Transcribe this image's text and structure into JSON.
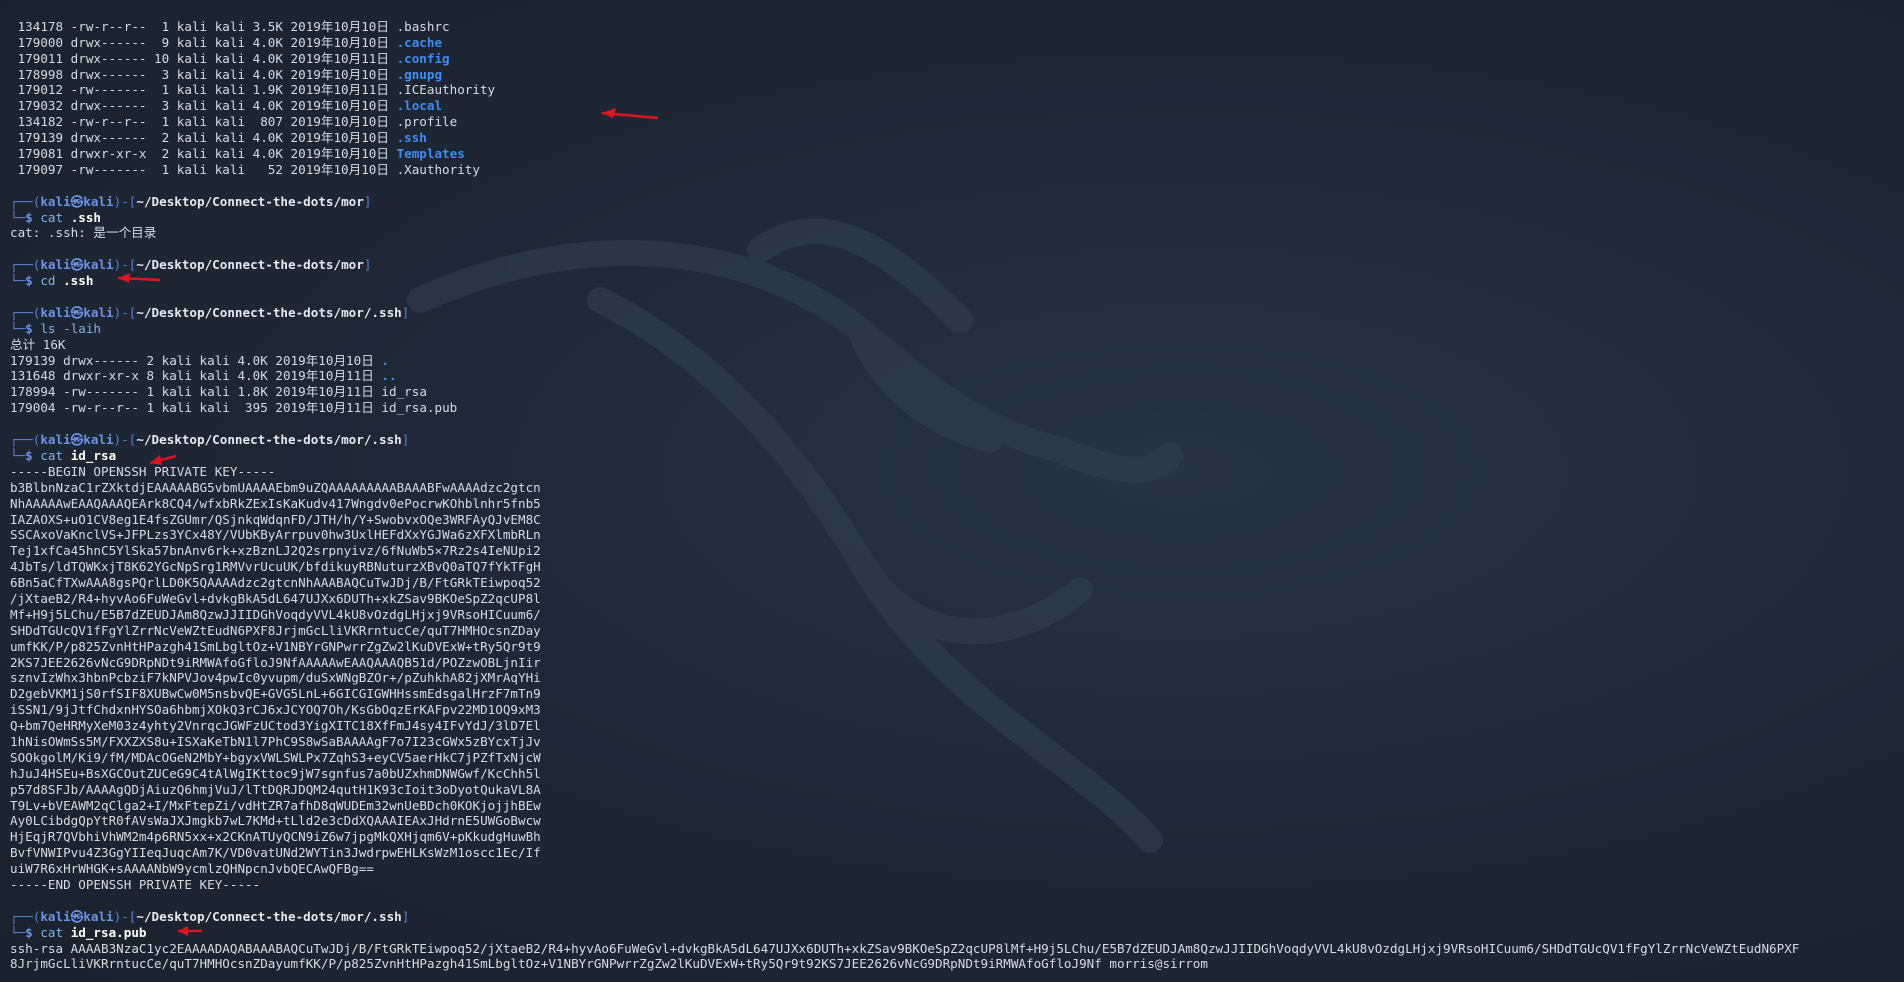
{
  "listing1": [
    {
      "inode": "134178",
      "perm": "-rw-r--r--",
      "links": " 1",
      "user": "kali",
      "group": "kali",
      "size": "3.5K",
      "date": "2019年10月10日",
      "name": ".bashrc",
      "dir": false
    },
    {
      "inode": "179000",
      "perm": "drwx------",
      "links": " 9",
      "user": "kali",
      "group": "kali",
      "size": "4.0K",
      "date": "2019年10月10日",
      "name": ".cache",
      "dir": true
    },
    {
      "inode": "179011",
      "perm": "drwx------",
      "links": "10",
      "user": "kali",
      "group": "kali",
      "size": "4.0K",
      "date": "2019年10月11日",
      "name": ".config",
      "dir": true
    },
    {
      "inode": "178998",
      "perm": "drwx------",
      "links": " 3",
      "user": "kali",
      "group": "kali",
      "size": "4.0K",
      "date": "2019年10月10日",
      "name": ".gnupg",
      "dir": true
    },
    {
      "inode": "179012",
      "perm": "-rw-------",
      "links": " 1",
      "user": "kali",
      "group": "kali",
      "size": "1.9K",
      "date": "2019年10月11日",
      "name": ".ICEauthority",
      "dir": false
    },
    {
      "inode": "179032",
      "perm": "drwx------",
      "links": " 3",
      "user": "kali",
      "group": "kali",
      "size": "4.0K",
      "date": "2019年10月10日",
      "name": ".local",
      "dir": true
    },
    {
      "inode": "134182",
      "perm": "-rw-r--r--",
      "links": " 1",
      "user": "kali",
      "group": "kali",
      "size": " 807",
      "date": "2019年10月10日",
      "name": ".profile",
      "dir": false
    },
    {
      "inode": "179139",
      "perm": "drwx------",
      "links": " 2",
      "user": "kali",
      "group": "kali",
      "size": "4.0K",
      "date": "2019年10月10日",
      "name": ".ssh",
      "dir": true
    },
    {
      "inode": "179081",
      "perm": "drwxr-xr-x",
      "links": " 2",
      "user": "kali",
      "group": "kali",
      "size": "4.0K",
      "date": "2019年10月10日",
      "name": "Templates",
      "dir": true
    },
    {
      "inode": "179097",
      "perm": "-rw-------",
      "links": " 1",
      "user": "kali",
      "group": "kali",
      "size": "  52",
      "date": "2019年10月10日",
      "name": ".Xauthority",
      "dir": false
    }
  ],
  "prompt": {
    "user": "kali",
    "at": "㉿",
    "host": "kali",
    "path_mor": "~/Desktop/Connect-the-dots/mor",
    "path_ssh": "~/Desktop/Connect-the-dots/mor/.ssh",
    "dollar": "$"
  },
  "commands": {
    "cat_ssh": {
      "name": "cat",
      "arg": ".ssh"
    },
    "cat_ssh_output": "cat: .ssh: 是一个目录",
    "cd_ssh": {
      "name": "cd",
      "arg": ".ssh"
    },
    "ls": {
      "name": "ls",
      "flag": "-laih"
    },
    "cat_idrsa": {
      "name": "cat",
      "arg": "id_rsa"
    },
    "cat_pub": {
      "name": "cat",
      "arg": "id_rsa.pub"
    }
  },
  "listing2_total": "总计 16K",
  "listing2": [
    {
      "inode": "179139",
      "perm": "drwx------",
      "links": "2",
      "user": "kali",
      "group": "kali",
      "size": "4.0K",
      "date": "2019年10月10日",
      "name": ".",
      "dir": true
    },
    {
      "inode": "131648",
      "perm": "drwxr-xr-x",
      "links": "8",
      "user": "kali",
      "group": "kali",
      "size": "4.0K",
      "date": "2019年10月11日",
      "name": "..",
      "dir": true
    },
    {
      "inode": "178994",
      "perm": "-rw-------",
      "links": "1",
      "user": "kali",
      "group": "kali",
      "size": "1.8K",
      "date": "2019年10月11日",
      "name": "id_rsa",
      "dir": false
    },
    {
      "inode": "179004",
      "perm": "-rw-r--r--",
      "links": "1",
      "user": "kali",
      "group": "kali",
      "size": " 395",
      "date": "2019年10月11日",
      "name": "id_rsa.pub",
      "dir": false
    }
  ],
  "private_key": [
    "-----BEGIN OPENSSH PRIVATE KEY-----",
    "b3BlbnNzaC1rZXktdjEAAAAABG5vbmUAAAAEbm9uZQAAAAAAAAABAAABFwAAAAdzc2gtcn",
    "NhAAAAAwEAAQAAAQEArk8CQ4/wfxbRkZExIsKaKudv417Wngdv0ePocrwKOhblnhr5fnb5",
    "IAZAOXS+uO1CV8eg1E4fsZGUmr/QSjnkqWdqnFD/JTH/h/Y+SwobvxOQe3WRFAyQJvEM8C",
    "SSCAxoVaKnclVS+JFPLzs3YCx48Y/VUbKByArrpuv0hw3UxlHEFdXxYGJWa6zXFXlmbRLn",
    "Tej1xfCa45hnC5YlSka57bnAnv6rk+xzBznLJ2Q2srpnyivz/6fNuWb5×7Rz2s4IeNUpi2",
    "4JbTs/ldTQWKxjT8K62YGcNpSrg1RMVvrUcuUK/bfdikuyRBNuturzXBvQ0aTQ7fYkTFgH",
    "6Bn5aCfTXwAAA8gsPQrlLD0K5QAAAAdzc2gtcnNhAAABAQCuTwJDj/B/FtGRkTEiwpoq52",
    "/jXtaeB2/R4+hyvAo6FuWeGvl+dvkgBkA5dL647UJXx6DUTh+xkZSav9BKOeSpZ2qcUP8l",
    "Mf+H9j5LChu/E5B7dZEUDJAm8QzwJJIIDGhVoqdyVVL4kU8vOzdgLHjxj9VRsoHICuum6/",
    "SHDdTGUcQV1fFgYlZrrNcVeWZtEudN6PXF8JrjmGcLliVKRrntucCe/quT7HMHOcsnZDay",
    "umfKK/P/p825ZvnHtHPazgh41SmLbgltOz+V1NBYrGNPwrrZgZw2lKuDVExW+tRy5Qr9t9",
    "2KS7JEE2626vNcG9DRpNDt9iRMWAfoGfloJ9NfAAAAAwEAAQAAAQB51d/POZzwOBLjnIir",
    "sznvIzWhx3hbnPcbziF7kNPVJov4pwIc0yvupm/duSxWNgBZOr+/pZuhkhA82jXMrAqYHi",
    "D2gebVKM1jS0rfSIF8XUBwCw0M5nsbvQE+GVG5LnL+6GICGIGWHHssmEdsgalHrzF7mTn9",
    "iSSN1/9jJtfChdxnHYSOa6hbmjXOkQ3rCJ6xJCYOQ7Oh/KsGbOqzErKAFpv22MD1OQ9xM3",
    "Q+bm7QeHRMyXeM03z4yhty2VnrqcJGWFzUCtod3YigXITC18XfFmJ4sy4IFvYdJ/3lD7El",
    "1hNisOWmSs5M/FXXZXS8u+ISXaKeTbN1l7PhC9S8wSaBAAAAgF7o7I23cGWx5zBYcxTjJv",
    "SOOkgolM/Ki9/fM/MDAcOGeN2MbY+bgyxVWLSWLPx7ZqhS3+eyCV5aerHkC7jPZfTxNjcW",
    "hJuJ4HSEu+BsXGCOutZUCeG9C4tAlWgIKttoc9jW7sgnfus7a0bUZxhmDNWGwf/KcChh5l",
    "p57d8SFJb/AAAAgQDjAiuzQ6hmjVuJ/lTtDQRJDQM24qutH1K93cIoit3oDyotQukaVL8A",
    "T9Lv+bVEAWM2qClga2+I/MxFtepZi/vdHtZR7afhD8qWUDEm32wnUeBDch0KOKjojjhBEw",
    "Ay0LCibdgQpYtR0fAVsWaJXJmgkb7wL7KMd+tLld2e3cDdXQAAAIEAxJHdrnE5UWGoBwcw",
    "HjEqjR7QVbhiVhWM2m4p6RN5xx+x2CKnATUyQCN9iZ6w7jpgMkQXHjqm6V+pKkudgHuwBh",
    "BvfVNWIPvu4Z3GgYIIeqJuqcAm7K/VD0vatUNd2WYTin3JwdrpwEHLKsWzM1oscc1Ec/If",
    "uiW7R6xHrWHGK+sAAAANbW9ycmlzQHNpcnJvbQECAwQFBg==",
    "-----END OPENSSH PRIVATE KEY-----"
  ],
  "pubkey": [
    "ssh-rsa AAAAB3NzaC1yc2EAAAADAQABAAABAQCuTwJDj/B/FtGRkTEiwpoq52/jXtaeB2/R4+hyvAo6FuWeGvl+dvkgBkA5dL647UJXx6DUTh+xkZSav9BKOeSpZ2qcUP8lMf+H9j5LChu/E5B7dZEUDJAm8QzwJJIIDGhVoqdyVVL4kU8vOzdgLHjxj9VRsoHICuum6/SHDdTGUcQV1fFgYlZrrNcVeWZtEudN6PXF",
    "8JrjmGcLliVKRrntucCe/quT7HMHOcsnZDayumfKK/P/p825ZvnHtHPazgh41SmLbgltOz+V1NBYrGNPwrrZgZw2lKuDVExW+tRy5Qr9t92KS7JEE2626vNcG9DRpNDt9iRMWAfoGfloJ9Nf morris@sirrom"
  ],
  "colors": {
    "background": "#1f2836",
    "prompt_frame": "#5a7fd1",
    "directory": "#3f8df0",
    "annotation_arrow": "#e0141e"
  }
}
